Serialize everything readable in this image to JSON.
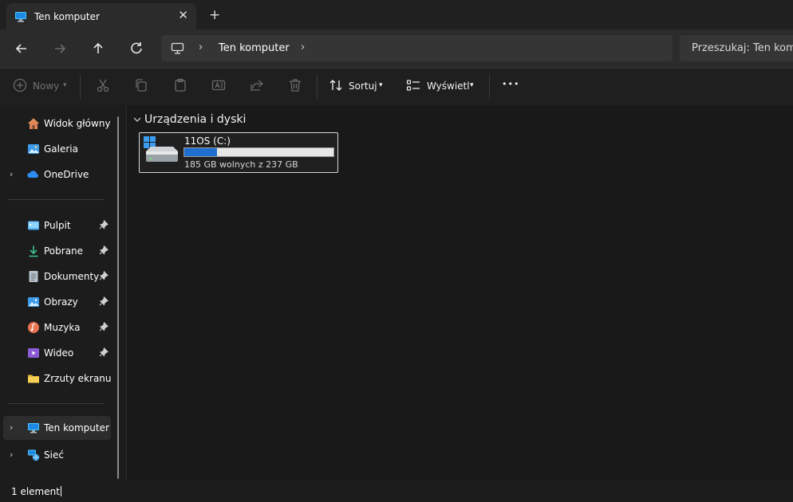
{
  "window": {
    "tab_title": "Ten komputer",
    "tab_icon": "computer-icon",
    "close_glyph": "✕",
    "new_tab_glyph": "+"
  },
  "navigation": {
    "back_icon": "arrow-left-icon",
    "forward_icon": "arrow-right-icon",
    "up_icon": "arrow-up-icon",
    "refresh_icon": "refresh-icon",
    "address_path": "Ten komputer",
    "search_placeholder": "Przeszukaj: Ten komputer"
  },
  "toolbar": {
    "new_label": "Nowy",
    "sort_label": "Sortuj",
    "view_label": "Wyświetl",
    "more_glyph": "•••",
    "icons": [
      "plus-circle-icon",
      "cut-icon",
      "copy-icon",
      "paste-icon",
      "rename-icon",
      "share-icon",
      "delete-icon",
      "sort-icon",
      "view-icon",
      "more-icon"
    ]
  },
  "sidebar": {
    "items": [
      {
        "label": "Widok główny",
        "icon": "home-icon"
      },
      {
        "label": "Galeria",
        "icon": "gallery-icon"
      },
      {
        "label": "OneDrive",
        "icon": "onedrive-icon",
        "expandable": true
      },
      {
        "label": "Pulpit",
        "icon": "desktop-icon",
        "pinned": true
      },
      {
        "label": "Pobrane",
        "icon": "download-icon",
        "pinned": true
      },
      {
        "label": "Dokumenty",
        "icon": "documents-icon",
        "pinned": true
      },
      {
        "label": "Obrazy",
        "icon": "pictures-icon",
        "pinned": true
      },
      {
        "label": "Muzyka",
        "icon": "music-icon",
        "pinned": true
      },
      {
        "label": "Wideo",
        "icon": "video-icon",
        "pinned": true
      },
      {
        "label": "Zrzuty ekranu",
        "icon": "folder-icon"
      },
      {
        "label": "Ten komputer",
        "icon": "computer-icon",
        "expandable": true,
        "selected": true
      },
      {
        "label": "Sieć",
        "icon": "network-icon",
        "expandable": true
      }
    ]
  },
  "main": {
    "group_title": "Urządzenia i dyski",
    "drives": [
      {
        "name": "11OS (C:)",
        "free_text": "185 GB wolnych z 237 GB",
        "used_fraction": 0.22
      }
    ]
  },
  "colors": {
    "accent": "#1f6fd1",
    "background": "#191919",
    "panel": "#2b2b2b"
  },
  "status": {
    "count_text": "1 element"
  }
}
